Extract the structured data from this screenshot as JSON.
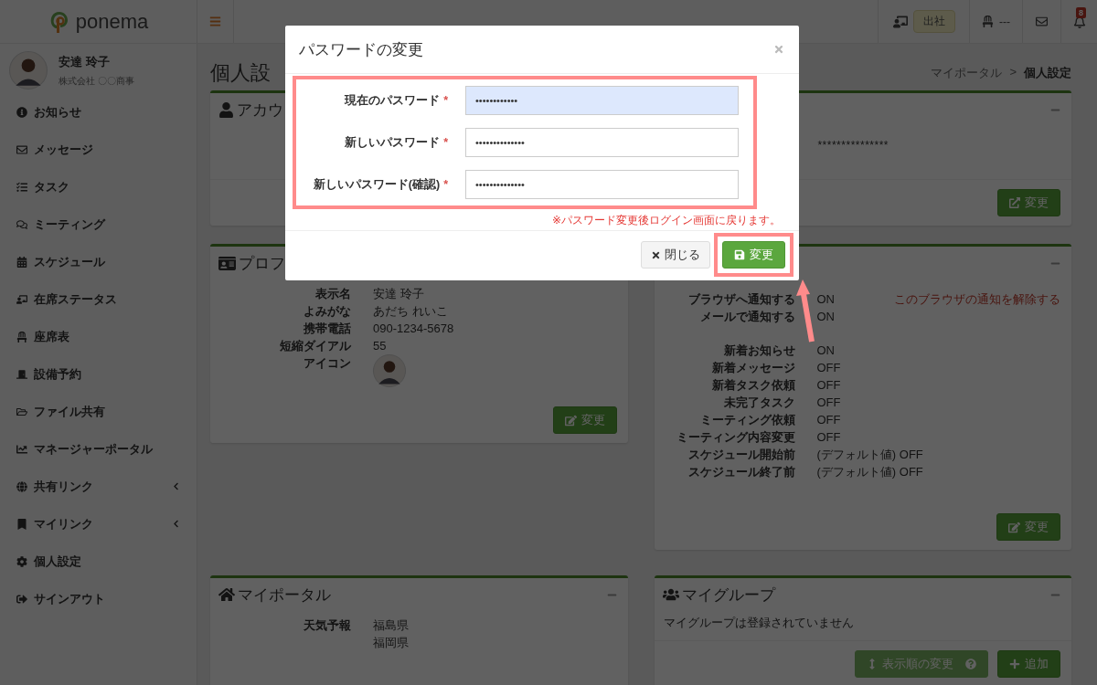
{
  "topbar": {
    "logo": "ponema",
    "presence": "出社",
    "seat": "---",
    "notification_count": "8"
  },
  "user": {
    "name": "安達 玲子",
    "company": "株式会社 〇〇商事"
  },
  "sidebar": {
    "items": [
      {
        "label": "お知らせ",
        "kind": "link"
      },
      {
        "label": "メッセージ",
        "kind": "link"
      },
      {
        "label": "タスク",
        "kind": "link"
      },
      {
        "label": "ミーティング",
        "kind": "link"
      },
      {
        "label": "スケジュール",
        "kind": "link"
      },
      {
        "label": "在席ステータス",
        "kind": "link"
      },
      {
        "label": "座席表",
        "kind": "link"
      },
      {
        "label": "設備予約",
        "kind": "link"
      },
      {
        "label": "ファイル共有",
        "kind": "link"
      },
      {
        "label": "マネージャーポータル",
        "kind": "link"
      },
      {
        "label": "共有リンク",
        "kind": "submenu"
      },
      {
        "label": "マイリンク",
        "kind": "submenu"
      },
      {
        "label": "個人設定",
        "kind": "link"
      },
      {
        "label": "サインアウト",
        "kind": "link"
      }
    ]
  },
  "page": {
    "title": "個人設",
    "separator": ">",
    "breadcrumb": [
      {
        "label": "マイポータル",
        "current": false
      },
      {
        "label": "個人設定",
        "current": true
      }
    ]
  },
  "account_card": {
    "title": "アカウ",
    "value": "***************",
    "button": "変更"
  },
  "profile_card": {
    "title": "プロフ",
    "button": "変更",
    "rows": [
      {
        "label": "表示名",
        "value": "安達 玲子",
        "kind": "text"
      },
      {
        "label": "よみがな",
        "value": "あだち れいこ",
        "kind": "text"
      },
      {
        "label": "携帯電話",
        "value": "090-1234-5678",
        "kind": "text"
      },
      {
        "label": "短縮ダイアル",
        "value": "55",
        "kind": "text"
      },
      {
        "label": "アイコン",
        "kind": "avatar"
      }
    ]
  },
  "notification_card": {
    "button": "変更",
    "groups": [
      {
        "rows": [
          {
            "label": "ブラウザへ通知する",
            "value": "ON",
            "action": "このブラウザの通知を解除する"
          },
          {
            "label": "メールで通知する",
            "value": "ON"
          }
        ]
      },
      {
        "rows": [
          {
            "label": "新着お知らせ",
            "value": "ON"
          },
          {
            "label": "新着メッセージ",
            "value": "OFF"
          },
          {
            "label": "新着タスク依頼",
            "value": "OFF"
          },
          {
            "label": "未完了タスク",
            "value": "OFF"
          },
          {
            "label": "ミーティング依頼",
            "value": "OFF"
          },
          {
            "label": "ミーティング内容変更",
            "value": "OFF"
          },
          {
            "label": "スケジュール開始前",
            "value": "(デフォルト値) OFF"
          },
          {
            "label": "スケジュール終了前",
            "value": "(デフォルト値) OFF"
          }
        ]
      }
    ]
  },
  "portal_card": {
    "title": "マイポータル",
    "rows": [
      {
        "label": "天気予報",
        "values": [
          "福島県",
          "福岡県"
        ]
      }
    ]
  },
  "group_card": {
    "title": "マイグループ",
    "empty_text": "マイグループは登録されていません",
    "buttons": [
      {
        "label": "表示順の変更",
        "kind": "reorder",
        "disabled": true
      },
      {
        "label": "追加",
        "kind": "add",
        "disabled": false
      }
    ]
  },
  "modal": {
    "title": "パスワードの変更",
    "note": "※パスワード変更後ログイン画面に戻ります。",
    "fields": [
      {
        "label": "現在のパスワード",
        "required_mark": "*",
        "value": "••••••••••••",
        "autofilled": true
      },
      {
        "label": "新しいパスワード",
        "required_mark": "*",
        "value": "••••••••••••••",
        "autofilled": false
      },
      {
        "label": "新しいパスワード(確認)",
        "required_mark": "*",
        "value": "••••••••••••••",
        "autofilled": false
      }
    ],
    "buttons": [
      {
        "label": "閉じる",
        "kind": "close"
      },
      {
        "label": "変更",
        "kind": "save"
      }
    ]
  }
}
